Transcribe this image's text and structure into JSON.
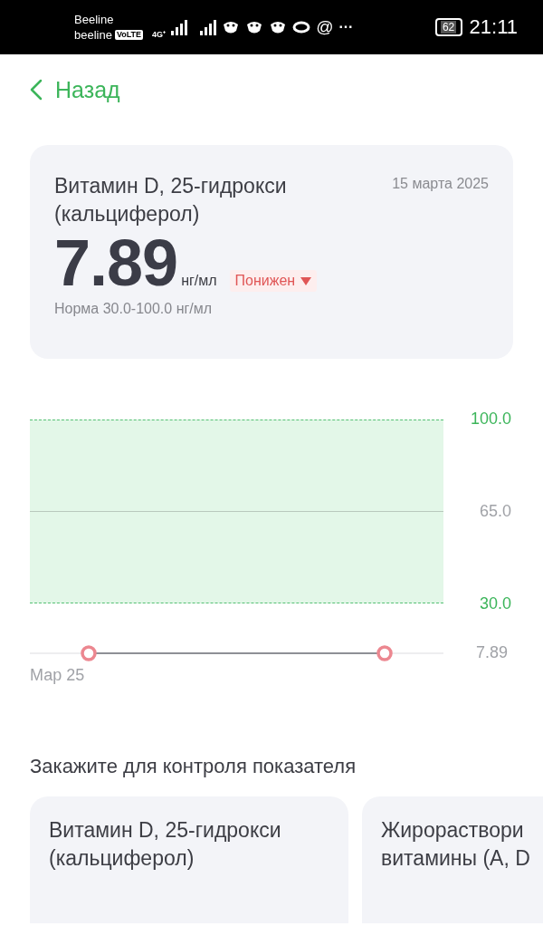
{
  "status_bar": {
    "carriers": [
      "Beeline",
      "beeline"
    ],
    "volte": "VoLTE",
    "network": "4G⁺",
    "at": "@",
    "more": "···",
    "battery": "62",
    "time": "21:11"
  },
  "back": {
    "label": "Назад"
  },
  "result": {
    "title": "Витамин D, 25-гидрокси (кальциферол)",
    "date": "15 марта 2025",
    "value": "7.89",
    "unit": "нг/мл",
    "status": {
      "label": "Понижен",
      "kind": "low"
    },
    "norm": "Норма 30.0-100.0 нг/мл"
  },
  "trend": {
    "range_labels": [
      "100.0",
      "65.0",
      "30.0"
    ],
    "value_label": "7.89",
    "date_label": "Мар 25"
  },
  "order_section": {
    "title": "Закажите для контроля показателя",
    "cards": [
      {
        "title_lines": [
          "Витамин D, 25-гидрокси",
          "(кальциферол)"
        ]
      },
      {
        "title_lines": [
          "Жирораствори",
          "витамины (A, D"
        ]
      }
    ]
  }
}
